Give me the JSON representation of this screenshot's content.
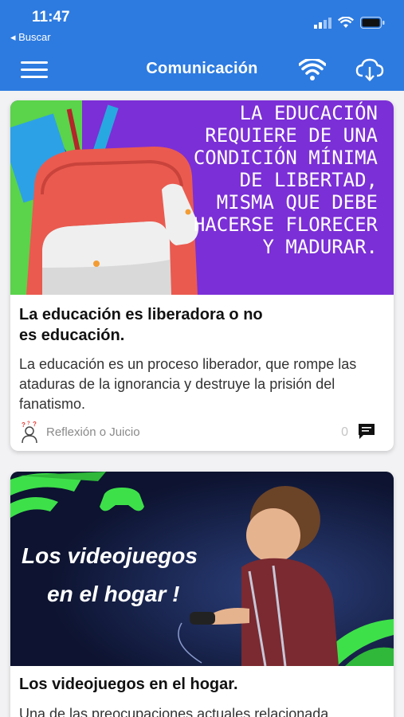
{
  "status_bar": {
    "time": "11:47",
    "back_label": "◂ Buscar"
  },
  "app_bar": {
    "title": "Comunicación",
    "color": "#2d7be0",
    "icons": [
      "menu-icon",
      "wifi-icon",
      "cloud-download-icon"
    ]
  },
  "posts": [
    {
      "image_text": "LA EDUCACIÓN REQUIERE DE UNA CONDICIÓN MÍNIMA DE LIBERTAD, MISMA QUE DEBE HACERSE FLORECER Y MADURAR.",
      "title": "La educación es liberadora o no es educación.",
      "description": "La educación es un proceso liberador, que rompe las ataduras de la ignorancia y destruye la prisión del fanatismo.",
      "category": "Reflexión o Juicio",
      "comments": "0"
    },
    {
      "image_text_line1": "Los videojuegos",
      "image_text_line2": "en el hogar !",
      "title": "Los videojuegos en el hogar.",
      "description": "Una de las preocupaciones actuales relacionada"
    }
  ]
}
